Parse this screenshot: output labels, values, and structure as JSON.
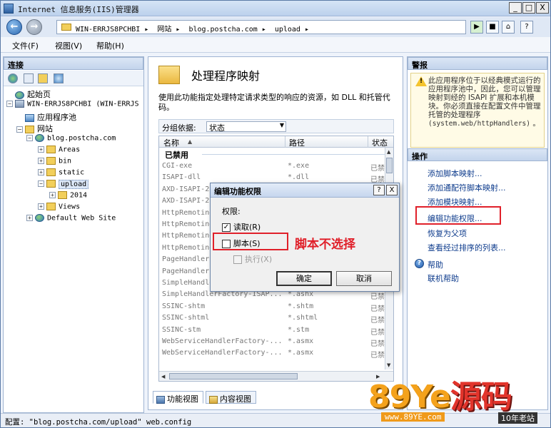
{
  "window": {
    "title": "Internet 信息服务(IIS)管理器",
    "min": "_",
    "max": "□",
    "close": "X"
  },
  "address": {
    "crumbs": [
      "WIN-ERRJS8PCHBI",
      "网站",
      "blog.postcha.com",
      "upload"
    ]
  },
  "menu": [
    "文件(F)",
    "视图(V)",
    "帮助(H)"
  ],
  "connections": {
    "header": "连接",
    "tree": [
      {
        "label": "起始页",
        "icon": "home-icon",
        "level": 1
      },
      {
        "label": "WIN-ERRJS8PCHBI (WIN-ERRJS",
        "icon": "server-icon",
        "level": 1
      },
      {
        "label": "应用程序池",
        "icon": "app-pool-icon",
        "level": 2
      },
      {
        "label": "网站",
        "icon": "folder-icon",
        "level": 2
      },
      {
        "label": "blog.postcha.com",
        "icon": "globe-icon",
        "level": 3
      },
      {
        "label": "Areas",
        "icon": "folder-icon",
        "level": 4
      },
      {
        "label": "bin",
        "icon": "folder-icon",
        "level": 4
      },
      {
        "label": "static",
        "icon": "folder-icon",
        "level": 4
      },
      {
        "label": "upload",
        "icon": "folder-icon",
        "level": 4
      },
      {
        "label": "2014",
        "icon": "folder-icon",
        "level": 5
      },
      {
        "label": "Views",
        "icon": "folder-icon",
        "level": 4
      },
      {
        "label": "Default Web Site",
        "icon": "globe-icon",
        "level": 3
      }
    ]
  },
  "feature": {
    "title": "处理程序映射",
    "description": "使用此功能指定处理特定请求类型的响应的资源，如 DLL 和托管代码。",
    "group_by_label": "分组依据:",
    "group_by_value": "状态",
    "columns": [
      "名称",
      "路径",
      "状态"
    ],
    "sort_indicator": "▲",
    "group_title": "已禁用",
    "rows": [
      {
        "name": "CGI-exe",
        "path": "*.exe",
        "state": "已禁"
      },
      {
        "name": "ISAPI-dll",
        "path": "*.dll",
        "state": "已禁"
      },
      {
        "name": "AXD-ISAPI-2",
        "path": "",
        "state": "已禁"
      },
      {
        "name": "AXD-ISAPI-2",
        "path": "",
        "state": "已禁"
      },
      {
        "name": "HttpRemoting",
        "path": "",
        "state": "已禁"
      },
      {
        "name": "HttpRemoting",
        "path": "",
        "state": "已禁"
      },
      {
        "name": "HttpRemoting",
        "path": "",
        "state": "已禁"
      },
      {
        "name": "HttpRemoting",
        "path": "",
        "state": "已禁"
      },
      {
        "name": "PageHandlerF",
        "path": "",
        "state": "已禁"
      },
      {
        "name": "PageHandlerF",
        "path": "",
        "state": "已禁"
      },
      {
        "name": "SimpleHandle",
        "path": "",
        "state": "已禁"
      },
      {
        "name": "SimpleHandlerFactory-ISAP...",
        "path": "*.ashx",
        "state": "已禁"
      },
      {
        "name": "SSINC-shtm",
        "path": "*.shtm",
        "state": "已禁"
      },
      {
        "name": "SSINC-shtml",
        "path": "*.shtml",
        "state": "已禁"
      },
      {
        "name": "SSINC-stm",
        "path": "*.stm",
        "state": "已禁"
      },
      {
        "name": "WebServiceHandlerFactory-...",
        "path": "*.asmx",
        "state": "已禁"
      },
      {
        "name": "WebServiceHandlerFactory-...",
        "path": "*.asmx",
        "state": "已禁"
      }
    ],
    "tabs": [
      "功能视图",
      "内容视图"
    ]
  },
  "alerts": {
    "header": "警报",
    "line1": "此应用程序位于以经典模式运行的应用程序池中，因此，您可以管理映射到经的 ISAPI 扩展和本机模块。你必须直接在配置文件中管理托管的处理程序",
    "line2": "(system.web/httpHandlers)",
    "line3": "。"
  },
  "actions": {
    "header": "操作",
    "items": [
      "添加脚本映射...",
      "添加通配符脚本映射...",
      "添加模块映射...",
      "编辑功能权限...",
      "恢复为父项",
      "查看经过排序的列表..."
    ],
    "help": [
      "帮助",
      "联机帮助"
    ]
  },
  "dialog": {
    "title": "编辑功能权限",
    "help_btn": "?",
    "close_btn": "X",
    "permissions_label": "权限:",
    "read_label": "读取(R)",
    "script_label": "脚本(S)",
    "execute_label": "执行(X)",
    "ok": "确定",
    "cancel": "取消"
  },
  "annotation": {
    "text": "脚本不选择"
  },
  "status": {
    "text": "配置: \"blog.postcha.com/upload\" web.config"
  },
  "watermark": {
    "text_a": "89Ye",
    "text_b": "源码",
    "url": "www.89YE.com",
    "tag": "10年老站"
  },
  "colors": {
    "annotation_red": "#e0202a",
    "link_blue": "#0d3b8c"
  }
}
